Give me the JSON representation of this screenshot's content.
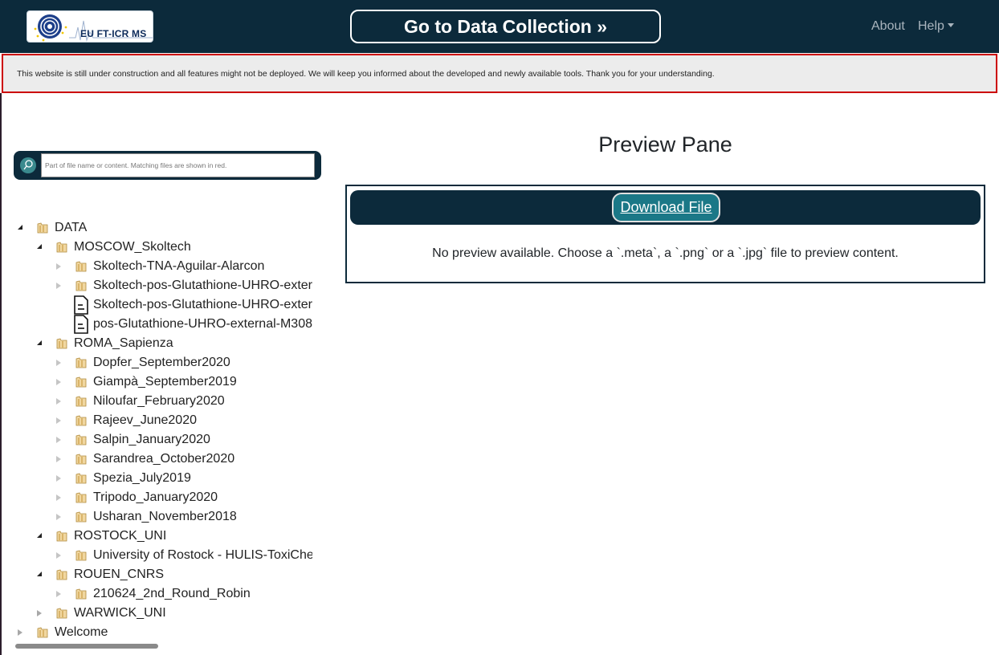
{
  "navbar": {
    "logo_text": "EU FT-ICR MS",
    "go_button": "Go to Data Collection »",
    "about": "About",
    "help": "Help"
  },
  "alert": {
    "text": "This website is still under construction and all features might not be deployed. We will keep you informed about the developed and newly available tools. Thank you for your understanding."
  },
  "search": {
    "placeholder": "Part of file name or content. Matching files are shown in red."
  },
  "tree": {
    "items": [
      {
        "label": "DATA",
        "depth": 0,
        "type": "folder",
        "state": "open"
      },
      {
        "label": "MOSCOW_Skoltech",
        "depth": 1,
        "type": "folder",
        "state": "open"
      },
      {
        "label": "Skoltech-TNA-Aguilar-Alarcon",
        "depth": 2,
        "type": "folder",
        "state": "closed"
      },
      {
        "label": "Skoltech-pos-Glutathione-UHRO-external",
        "depth": 2,
        "type": "folder",
        "state": "closed"
      },
      {
        "label": "Skoltech-pos-Glutathione-UHRO-external",
        "depth": 2,
        "type": "file",
        "state": "none"
      },
      {
        "label": "pos-Glutathione-UHRO-external-M308",
        "depth": 2,
        "type": "file",
        "state": "none"
      },
      {
        "label": "ROMA_Sapienza",
        "depth": 1,
        "type": "folder",
        "state": "open"
      },
      {
        "label": "Dopfer_September2020",
        "depth": 2,
        "type": "folder",
        "state": "closed"
      },
      {
        "label": "Giampà_September2019",
        "depth": 2,
        "type": "folder",
        "state": "closed"
      },
      {
        "label": "Niloufar_February2020",
        "depth": 2,
        "type": "folder",
        "state": "closed"
      },
      {
        "label": "Rajeev_June2020",
        "depth": 2,
        "type": "folder",
        "state": "closed"
      },
      {
        "label": "Salpin_January2020",
        "depth": 2,
        "type": "folder",
        "state": "closed"
      },
      {
        "label": "Sarandrea_October2020",
        "depth": 2,
        "type": "folder",
        "state": "closed"
      },
      {
        "label": "Spezia_July2019",
        "depth": 2,
        "type": "folder",
        "state": "closed"
      },
      {
        "label": "Tripodo_January2020",
        "depth": 2,
        "type": "folder",
        "state": "closed"
      },
      {
        "label": "Usharan_November2018",
        "depth": 2,
        "type": "folder",
        "state": "closed"
      },
      {
        "label": "ROSTOCK_UNI",
        "depth": 1,
        "type": "folder",
        "state": "open"
      },
      {
        "label": "University of Rostock - HULIS-ToxiChem",
        "depth": 2,
        "type": "folder",
        "state": "closed"
      },
      {
        "label": "ROUEN_CNRS",
        "depth": 1,
        "type": "folder",
        "state": "open"
      },
      {
        "label": "210624_2nd_Round_Robin",
        "depth": 2,
        "type": "folder",
        "state": "closed"
      },
      {
        "label": "WARWICK_UNI",
        "depth": 1,
        "type": "folder",
        "state": "closed"
      },
      {
        "label": "Welcome",
        "depth": 0,
        "type": "folder",
        "state": "closed"
      }
    ]
  },
  "preview": {
    "title": "Preview Pane",
    "download_label": "Download File",
    "message": "No preview available. Choose a `.meta`, a `.png` or a `.jpg` file to preview content."
  },
  "colors": {
    "navbar_bg": "#0c2a3b",
    "alert_border": "#cc0000",
    "download_btn": "#1b7887"
  }
}
